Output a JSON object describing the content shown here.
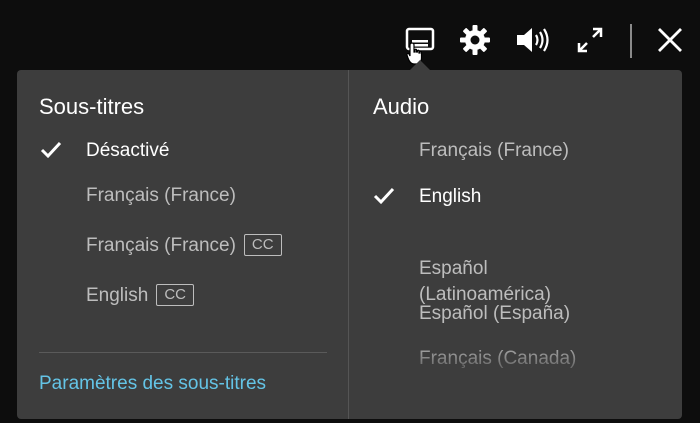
{
  "controls": {
    "subtitles_icon": "subtitles-icon",
    "settings_icon": "gear-icon",
    "volume_icon": "volume-icon",
    "fullscreen_icon": "fullscreen-icon",
    "close_icon": "close-icon"
  },
  "subtitles": {
    "heading": "Sous-titres",
    "options": [
      {
        "label": "Désactivé",
        "selected": true,
        "cc": ""
      },
      {
        "label": "Français (France)",
        "selected": false,
        "cc": ""
      },
      {
        "label": "Français (France)",
        "selected": false,
        "cc": "CC"
      },
      {
        "label": "English",
        "selected": false,
        "cc": "CC"
      }
    ],
    "settings_link": "Paramètres des sous-titres"
  },
  "audio": {
    "heading": "Audio",
    "options": [
      {
        "label": "Français (France)",
        "selected": false
      },
      {
        "label": "English",
        "selected": true
      },
      {
        "label": "Español\n(Latinoamérica)",
        "selected": false
      },
      {
        "label": "Español (España)",
        "selected": false
      },
      {
        "label": "Français (Canada)",
        "selected": false
      }
    ]
  },
  "colors": {
    "panel_bg": "#3d3d3d",
    "page_bg": "#0d0d0d",
    "link": "#64c4e6",
    "option_text": "#bdbdbd",
    "selected_text": "#ffffff"
  }
}
